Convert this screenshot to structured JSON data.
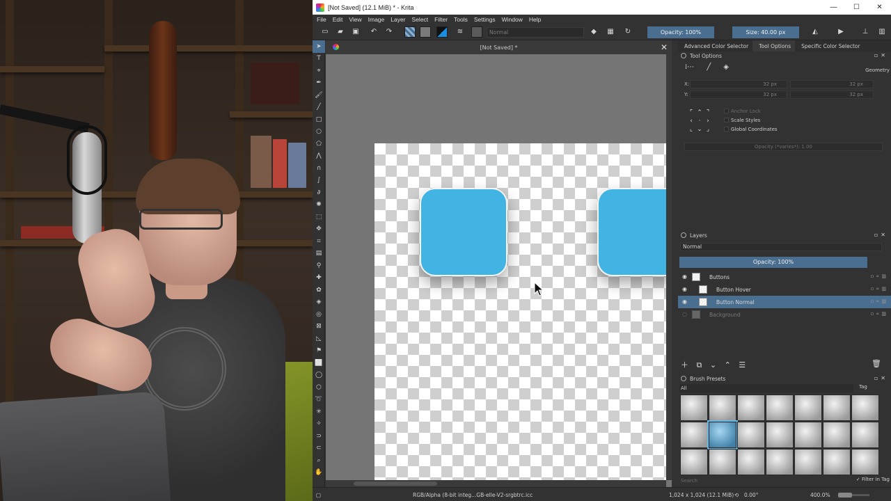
{
  "titlebar": {
    "title": "[Not Saved]  (12.1 MiB)  * - Krita",
    "minimize": "—",
    "maximize": "☐",
    "close": "✕"
  },
  "menu": [
    "File",
    "Edit",
    "View",
    "Image",
    "Layer",
    "Select",
    "Filter",
    "Tools",
    "Settings",
    "Window",
    "Help"
  ],
  "toolbar": {
    "blend_mode": "Normal",
    "opacity": "Opacity: 100%",
    "size": "Size: 40.00 px"
  },
  "document_tab": {
    "title": "[Not Saved]  *",
    "close": "✕"
  },
  "docker_tabs": [
    "Advanced Color Selector",
    "Tool Options",
    "Specific Color Selector"
  ],
  "active_docker_tab": "Tool Options",
  "tool_options": {
    "header": "Tool Options",
    "geometry_label": "Geometry",
    "x_label": "X:",
    "y_label": "Y:",
    "x_value": "32 px",
    "x_value2": "32 px",
    "y_value": "32 px",
    "y_value2": "32 px",
    "anchor_lock": "Anchor Lock",
    "scale_styles": "Scale Styles",
    "global_coordinates": "Global Coordinates",
    "opacity": "Opacity (*varies*): 1.00"
  },
  "layers": {
    "header": "Layers",
    "blend_mode": "Normal",
    "opacity": "Opacity:  100%",
    "items": [
      {
        "name": "Buttons",
        "type": "group"
      },
      {
        "name": "Button Hover",
        "type": "layer"
      },
      {
        "name": "Button Normal",
        "type": "layer",
        "selected": true
      },
      {
        "name": "Background",
        "type": "layer",
        "hidden": true
      }
    ]
  },
  "brush_presets": {
    "header": "Brush Presets",
    "filter": "All",
    "tag_label": "Tag",
    "search_placeholder": "Search",
    "filter_in_tag": "Filter in Tag"
  },
  "statusbar": {
    "color_space": "RGB/Alpha (8-bit integ...GB-elle-V2-srgbtrc.icc",
    "dimensions": "1,024 x 1,024 (12.1 MiB)",
    "rotation": "0.00°",
    "zoom": "400.0%"
  },
  "colors": {
    "accent": "#4a6e8f",
    "button_fill": "#41b4e4",
    "panel_bg": "#323232"
  }
}
